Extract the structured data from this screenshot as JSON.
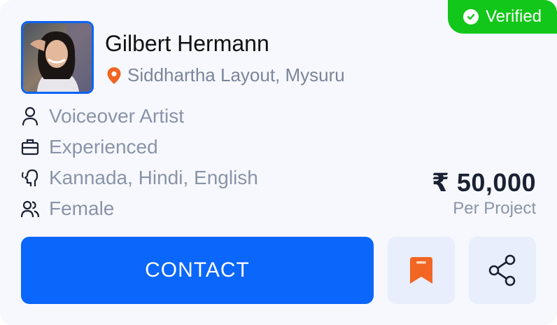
{
  "badge": {
    "label": "Verified",
    "color": "#12c719",
    "icon": "check-circle-icon"
  },
  "profile": {
    "name": "Gilbert Hermann",
    "location": "Siddhartha Layout, Mysuru",
    "location_icon": "map-pin-icon"
  },
  "attributes": [
    {
      "icon": "user-icon",
      "text": "Voiceover Artist"
    },
    {
      "icon": "briefcase-icon",
      "text": "Experienced"
    },
    {
      "icon": "speaking-head-icon",
      "text": "Kannada, Hindi, English"
    },
    {
      "icon": "users-icon",
      "text": "Female"
    }
  ],
  "price": {
    "amount": "₹ 50,000",
    "unit": "Per Project"
  },
  "actions": {
    "contact_label": "CONTACT",
    "contact_color": "#0b66fb",
    "bookmark_icon": "bookmark-icon",
    "bookmark_color": "#f26522",
    "share_icon": "share-icon"
  }
}
